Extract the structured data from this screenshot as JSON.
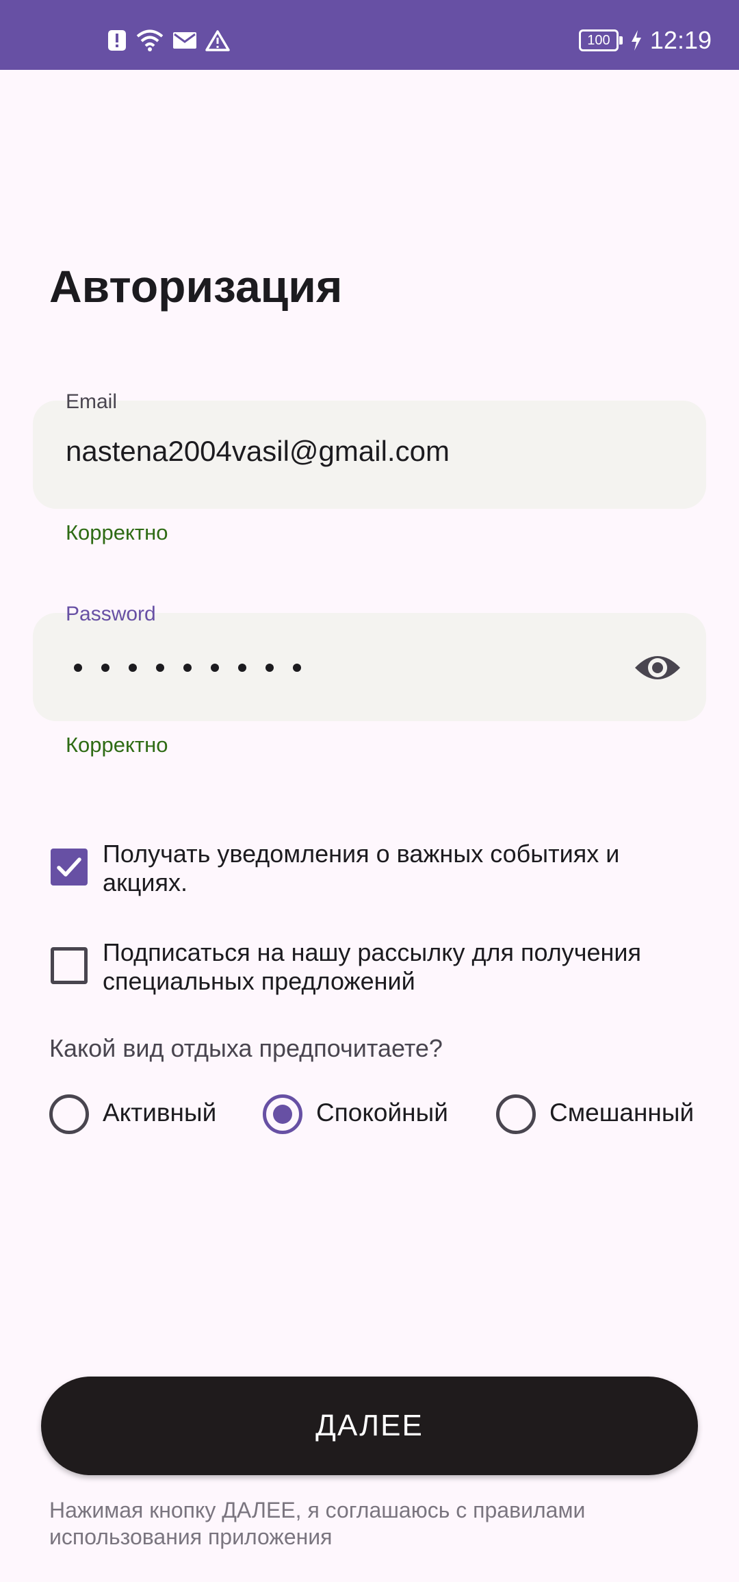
{
  "status_bar": {
    "time": "12:19",
    "battery": "100",
    "icons_left": [
      "alert-icon",
      "wifi-icon",
      "mail-icon",
      "warning-icon"
    ],
    "background": "#6750A4"
  },
  "title": "Авторизация",
  "email": {
    "label": "Email",
    "value": "nastena2004vasil@gmail.com",
    "helper": "Корректно"
  },
  "password": {
    "label": "Password",
    "masked_length": 9,
    "helper": "Корректно",
    "toggle_icon": "eye-icon"
  },
  "checkboxes": [
    {
      "label": "Получать уведомления о важных событиях и акциях.",
      "checked": true
    },
    {
      "label": "Подписаться на нашу рассылку для получения специальных предложений",
      "checked": false
    }
  ],
  "question": "Какой вид отдыха предпочитаете?",
  "radios": [
    {
      "label": "Активный",
      "selected": false
    },
    {
      "label": "Спокойный",
      "selected": true
    },
    {
      "label": "Смешанный",
      "selected": false
    }
  ],
  "next_button": "ДАЛЕЕ",
  "terms": "Нажимая кнопку ДАЛЕЕ, я соглашаюсь с правилами использования приложения",
  "colors": {
    "accent": "#6750A4",
    "success": "#2E6B14",
    "field_bg": "#F4F3F0",
    "button_bg": "#1F1B1C"
  }
}
